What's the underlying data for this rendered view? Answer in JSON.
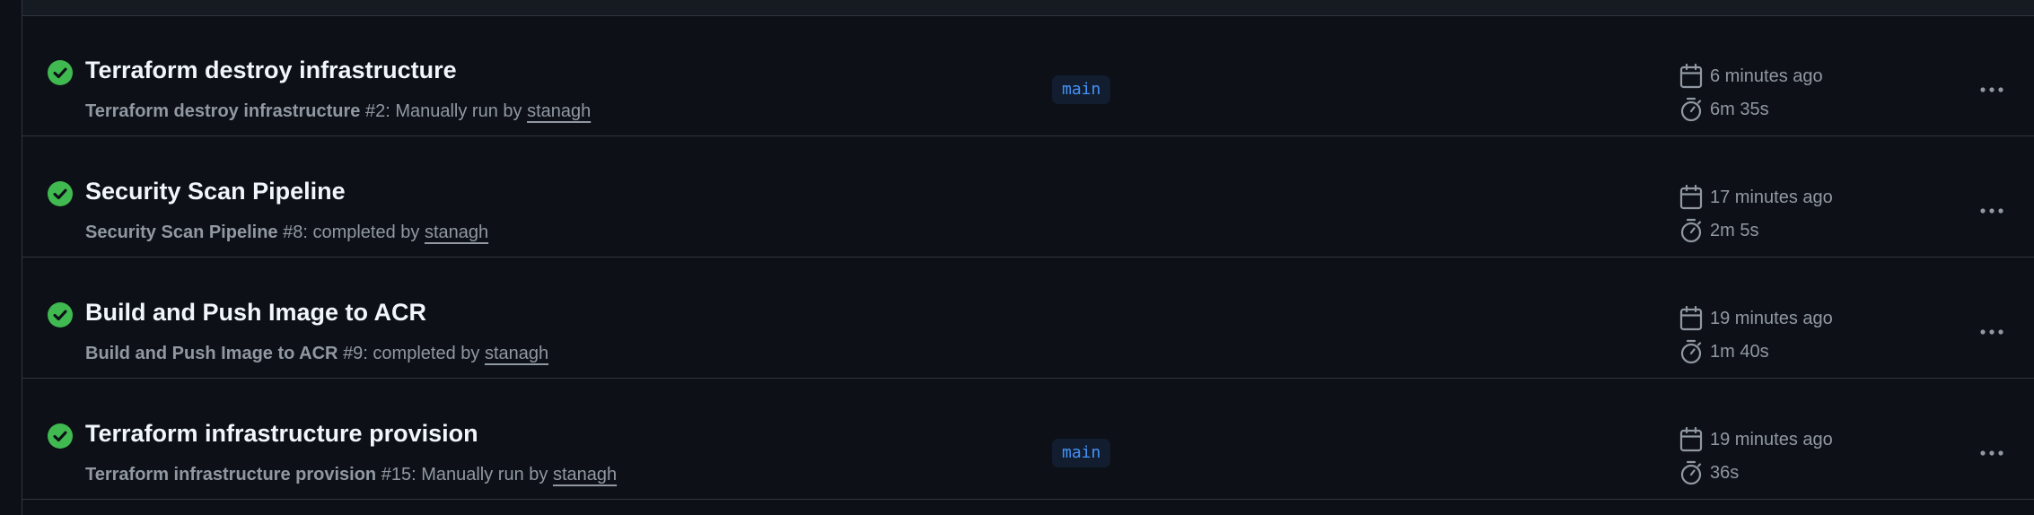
{
  "runs": [
    {
      "title": "Terraform destroy infrastructure",
      "workflow": "Terraform destroy infrastructure",
      "run_number": "#2",
      "event_text": ": Manually run by ",
      "actor": "stanagh",
      "branch": "main",
      "when": "6 minutes ago",
      "duration": "6m 35s",
      "status": "success"
    },
    {
      "title": "Security Scan Pipeline",
      "workflow": "Security Scan Pipeline",
      "run_number": "#8",
      "event_text": ": completed by ",
      "actor": "stanagh",
      "branch": "",
      "when": "17 minutes ago",
      "duration": "2m 5s",
      "status": "success"
    },
    {
      "title": "Build and Push Image to ACR",
      "workflow": "Build and Push Image to ACR",
      "run_number": "#9",
      "event_text": ": completed by ",
      "actor": "stanagh",
      "branch": "",
      "when": "19 minutes ago",
      "duration": "1m 40s",
      "status": "success"
    },
    {
      "title": "Terraform infrastructure provision",
      "workflow": "Terraform infrastructure provision",
      "run_number": "#15",
      "event_text": ": Manually run by ",
      "actor": "stanagh",
      "branch": "main",
      "when": "19 minutes ago",
      "duration": "36s",
      "status": "success"
    }
  ],
  "icons": {
    "status": "check-circle-fill-icon",
    "when": "calendar-icon",
    "duration": "stopwatch-icon",
    "menu": "kebab-horizontal-icon"
  },
  "colors": {
    "success": "#3fb950",
    "branch_text": "#4493f8",
    "branch_bg": "#121d2f",
    "background": "#0d1117"
  }
}
